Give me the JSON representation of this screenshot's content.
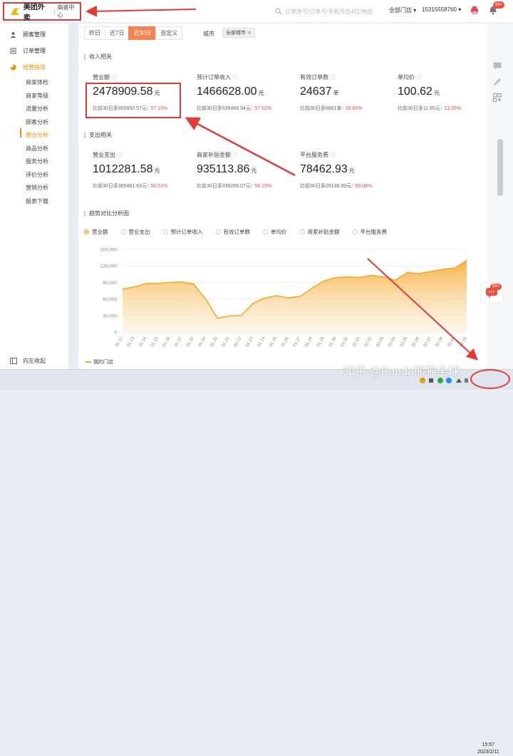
{
  "header": {
    "brand": "美团外卖",
    "subtitle": "商家中心",
    "search_placeholder": "订单序号/订单号/手机号后4位/地址",
    "store_select": "全部门店",
    "phone": "15315558760",
    "notification_badge": "99+"
  },
  "sidebar": {
    "items": [
      {
        "label": "顾客管理",
        "icon": "people-icon"
      },
      {
        "label": "订单管理",
        "icon": "order-icon"
      },
      {
        "label": "经营指导",
        "icon": "chart-icon"
      }
    ],
    "sub_items": [
      "商家体检",
      "商家等级",
      "流量分析",
      "顾客分析",
      "营业分析",
      "商品分析",
      "服务分析",
      "评价分析",
      "营销分析",
      "报表下载"
    ],
    "active_sub": "营业分析",
    "collapse_label": "向左收起"
  },
  "filters": {
    "tabs": [
      "昨日",
      "近7日",
      "近30日",
      "自定义"
    ],
    "active_tab": "近30日",
    "city_label": "城市",
    "city_chip": "全部城市"
  },
  "income": {
    "section_title": "收入相关",
    "metrics": [
      {
        "label": "营业额",
        "value": "2478909.58",
        "unit": "元",
        "cmp_prefix": "比前30日多900950.57元",
        "cmp_pct": "↑ 57.10%"
      },
      {
        "label": "预计订单收入",
        "value": "1466628.00",
        "unit": "元",
        "cmp_prefix": "比前30日多535468.94元",
        "cmp_pct": "↑ 57.51%"
      },
      {
        "label": "有效订单数",
        "value": "24637",
        "unit": "单",
        "cmp_prefix": "比前30日多6861单",
        "cmp_pct": "↑ 38.60%"
      },
      {
        "label": "单均价",
        "value": "100.62",
        "unit": "元",
        "cmp_prefix": "比前30日多11.85元",
        "cmp_pct": "↑ 13.35%"
      }
    ]
  },
  "expense": {
    "section_title": "支出相关",
    "metrics": [
      {
        "label": "营业支出",
        "value": "1012281.58",
        "unit": "元",
        "cmp_prefix": "比前30日多365481.63元",
        "cmp_pct": "↑ 56.51%"
      },
      {
        "label": "商家补贴金额",
        "value": "935113.86",
        "unit": "元",
        "cmp_prefix": "比前30日多336266.07元",
        "cmp_pct": "↑ 56.15%"
      },
      {
        "label": "平台服务费",
        "value": "78462.93",
        "unit": "元",
        "cmp_prefix": "比前30日多29138.99元",
        "cmp_pct": "↑ 59.08%"
      }
    ]
  },
  "trend": {
    "section_title": "趋势对比分析图",
    "legend": [
      "营业额",
      "营业支出",
      "预计订单收入",
      "有效订单数",
      "单均价",
      "商家补贴金额",
      "平台服务费"
    ],
    "active_legend": "营业额",
    "series_label": "我的门店"
  },
  "chart_data": {
    "type": "area",
    "categories": [
      "01.12",
      "01.13",
      "01.14",
      "01.15",
      "01.16",
      "01.17",
      "01.18",
      "01.19",
      "01.20",
      "01.21",
      "01.22",
      "01.23",
      "01.24",
      "01.25",
      "01.26",
      "01.27",
      "01.28",
      "01.29",
      "01.30",
      "01.31",
      "02.01",
      "02.02",
      "02.03",
      "02.04",
      "02.05",
      "02.06",
      "02.07",
      "02.08",
      "02.09",
      "02.10"
    ],
    "series": [
      {
        "name": "营业额",
        "values": [
          78000,
          82000,
          88000,
          88000,
          90000,
          91000,
          87000,
          60000,
          25000,
          29000,
          30000,
          52000,
          62000,
          66000,
          62000,
          65000,
          80000,
          93000,
          99000,
          100000,
          99000,
          103000,
          100000,
          94000,
          108000,
          106000,
          110000,
          114000,
          116000,
          130000
        ]
      }
    ],
    "yticks": [
      0,
      30000,
      60000,
      90000,
      120000,
      150000
    ],
    "ytick_labels": [
      "0",
      "30,000",
      "60,000",
      "90,000",
      "120,000",
      "150,000"
    ],
    "ylim": [
      0,
      150000
    ],
    "color": "#f5a623",
    "grid": true
  },
  "taskbar": {
    "time": "15:57",
    "date": "2023/2/11",
    "watermark": "知乎 @Panda熊猫全球"
  },
  "colors": {
    "accent": "#f5834f",
    "highlight": "#e53935",
    "up": "#f0503c",
    "orange": "#f5a623"
  }
}
